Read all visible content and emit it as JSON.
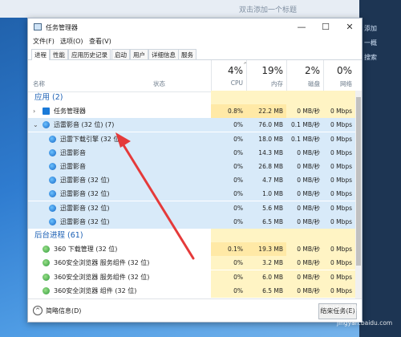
{
  "desktop": {
    "top_hint": "双击添加一个标题",
    "side_items": [
      "添加",
      "一概",
      "搜索"
    ]
  },
  "window": {
    "title": "任务管理器",
    "controls": [
      "—",
      "☐",
      "✕"
    ],
    "menu": [
      "文件(F)",
      "选项(O)",
      "查看(V)"
    ],
    "tabs": [
      "进程",
      "性能",
      "应用历史记录",
      "启动",
      "用户",
      "详细信息",
      "服务"
    ],
    "active_tab": 0
  },
  "header": {
    "name_label": "名称",
    "status_label": "状态",
    "sort_glyph": "^",
    "columns": [
      {
        "pct": "4%",
        "label": "CPU"
      },
      {
        "pct": "19%",
        "label": "内存"
      },
      {
        "pct": "2%",
        "label": "磁盘"
      },
      {
        "pct": "0%",
        "label": "网络"
      }
    ]
  },
  "rows": [
    {
      "kind": "group",
      "name": "应用 (2)"
    },
    {
      "kind": "proc",
      "name": "任务管理器",
      "icon": "task-manager-icon",
      "expand": ">",
      "cpu": "0.8%",
      "mem": "22.2 MB",
      "disk": "0 MB/秒",
      "net": "0 Mbps",
      "heat": "yellow2"
    },
    {
      "kind": "proc",
      "name": "迅雷影音 (32 位) (7)",
      "icon": "xunlei-player-icon",
      "expand": "v",
      "cpu": "0%",
      "mem": "76.0 MB",
      "disk": "0.1 MB/秒",
      "net": "0 Mbps",
      "selected": true
    },
    {
      "kind": "child",
      "name": "迅雷下载引擎 (32 位)",
      "cpu": "0%",
      "mem": "18.0 MB",
      "disk": "0.1 MB/秒",
      "net": "0 Mbps",
      "selected": true
    },
    {
      "kind": "child",
      "name": "迅雷影音",
      "cpu": "0%",
      "mem": "14.3 MB",
      "disk": "0 MB/秒",
      "net": "0 Mbps",
      "selected": true
    },
    {
      "kind": "child",
      "name": "迅雷影音",
      "cpu": "0%",
      "mem": "26.8 MB",
      "disk": "0 MB/秒",
      "net": "0 Mbps",
      "selected": true
    },
    {
      "kind": "child",
      "name": "迅雷影音 (32 位)",
      "cpu": "0%",
      "mem": "4.7 MB",
      "disk": "0 MB/秒",
      "net": "0 Mbps",
      "selected": true
    },
    {
      "kind": "child",
      "name": "迅雷影音 (32 位)",
      "cpu": "0%",
      "mem": "1.0 MB",
      "disk": "0 MB/秒",
      "net": "0 Mbps",
      "selected": true
    },
    {
      "kind": "child",
      "name": "迅雷影音 (32 位)",
      "cpu": "0%",
      "mem": "5.6 MB",
      "disk": "0 MB/秒",
      "net": "0 Mbps",
      "selected": true
    },
    {
      "kind": "child",
      "name": "迅雷影音 (32 位)",
      "cpu": "0%",
      "mem": "6.5 MB",
      "disk": "0 MB/秒",
      "net": "0 Mbps",
      "selected": true
    },
    {
      "kind": "group",
      "name": "后台进程 (61)"
    },
    {
      "kind": "proc",
      "name": "360 下载管理 (32 位)",
      "icon": "360-download-icon",
      "cpu": "0.1%",
      "mem": "19.3 MB",
      "disk": "0 MB/秒",
      "net": "0 Mbps",
      "heat": "yellow2"
    },
    {
      "kind": "proc",
      "name": "360安全浏览器 服务组件 (32 位)",
      "icon": "360-browser-icon",
      "cpu": "0%",
      "mem": "3.2 MB",
      "disk": "0 MB/秒",
      "net": "0 Mbps"
    },
    {
      "kind": "proc",
      "name": "360安全浏览器 服务组件 (32 位)",
      "icon": "360-browser-icon",
      "cpu": "0%",
      "mem": "6.0 MB",
      "disk": "0 MB/秒",
      "net": "0 Mbps"
    },
    {
      "kind": "proc",
      "name": "360安全浏览器 组件 (32 位)",
      "icon": "360-browser-icon",
      "cpu": "0%",
      "mem": "6.5 MB",
      "disk": "0 MB/秒",
      "net": "0 Mbps"
    }
  ],
  "footer": {
    "collapse_label": "简略信息(D)",
    "end_task_label": "结束任务(E)"
  },
  "watermark": {
    "line1": "Baidu 经验",
    "line2": "jingyan.baidu.com"
  },
  "colors": {
    "selection": "#d8eaf9",
    "heat_light": "#fff4c4",
    "heat_strong": "#ffe9a6",
    "group_text": "#1a5fb4",
    "arrow": "#e53a3a"
  }
}
